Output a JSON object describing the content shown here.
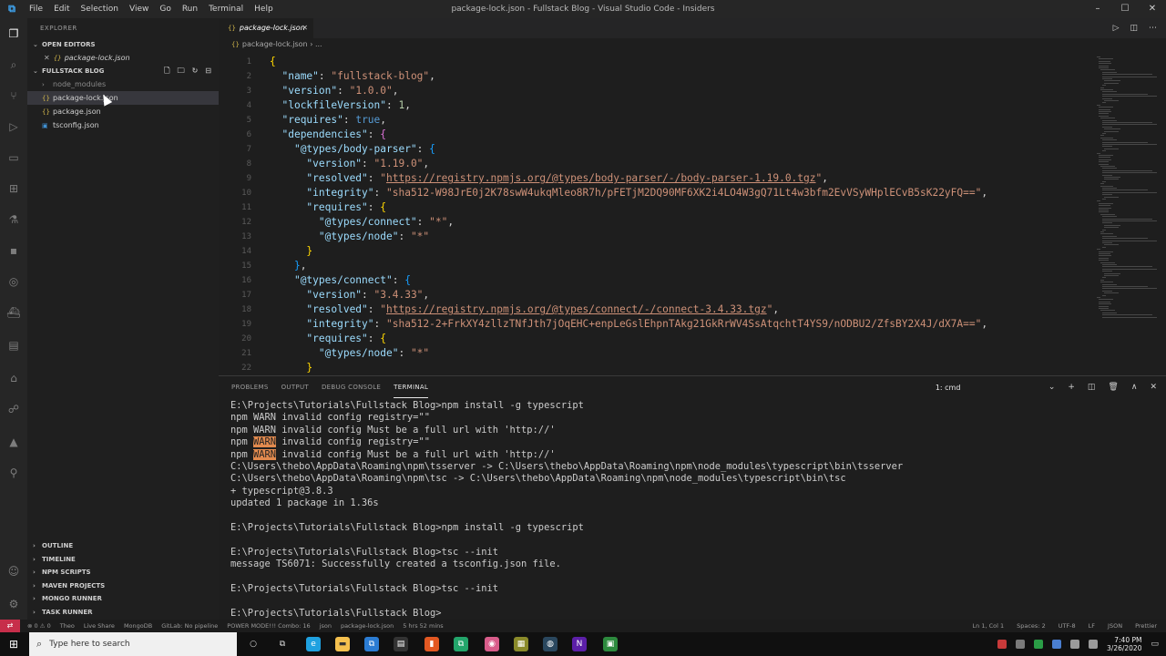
{
  "window": {
    "logo": "⧉",
    "title": "package-lock.json - Fullstack Blog - Visual Studio Code - Insiders",
    "menu": [
      "File",
      "Edit",
      "Selection",
      "View",
      "Go",
      "Run",
      "Terminal",
      "Help"
    ],
    "controls": [
      "–",
      "☐",
      "✕"
    ]
  },
  "activity_bar": {
    "icons": [
      "files-icon",
      "search-icon",
      "source-control-icon",
      "run-debug-icon",
      "remote-explorer-icon",
      "extensions-icon",
      "testing-icon",
      "npm-icon",
      "database-icon",
      "docker-icon",
      "terminal-icon",
      "bookmarks-icon",
      "git-graph-icon",
      "alert-icon",
      "accounts-icon",
      "settings-icon"
    ]
  },
  "sidebar": {
    "header": "EXPLORER",
    "open_editors_label": "OPEN EDITORS",
    "open_editor_file": "package-lock.json",
    "open_editor_close": "✕",
    "workspace_label": "FULLSTACK BLOG",
    "files": [
      {
        "name": "node_modules",
        "kind": "folder"
      },
      {
        "name": "package-lock.json",
        "kind": "json"
      },
      {
        "name": "package.json",
        "kind": "json"
      },
      {
        "name": "tsconfig.json",
        "kind": "ts"
      }
    ],
    "bottom_sections": [
      "OUTLINE",
      "TIMELINE",
      "NPM SCRIPTS",
      "MAVEN PROJECTS",
      "MONGO RUNNER",
      "TASK RUNNER"
    ]
  },
  "tabs": {
    "active": "package-lock.json",
    "icon": "{}",
    "close": "✕"
  },
  "breadcrumb": {
    "file": "package-lock.json",
    "sep": "›",
    "more": "..."
  },
  "editor": {
    "line_numbers": [
      "1",
      "2",
      "3",
      "4",
      "5",
      "6",
      "7",
      "8",
      "9",
      "10",
      "11",
      "12",
      "13",
      "14",
      "15",
      "16",
      "17",
      "18",
      "19",
      "20",
      "21",
      "22"
    ],
    "lines": [
      {
        "indent": "",
        "tokens": [
          {
            "t": "{",
            "c": "br1"
          }
        ]
      },
      {
        "indent": "  ",
        "tokens": [
          {
            "t": "\"name\"",
            "c": "k"
          },
          {
            "t": ": ",
            "c": ""
          },
          {
            "t": "\"fullstack-blog\"",
            "c": "s"
          },
          {
            "t": ",",
            "c": ""
          }
        ]
      },
      {
        "indent": "  ",
        "tokens": [
          {
            "t": "\"version\"",
            "c": "k"
          },
          {
            "t": ": ",
            "c": ""
          },
          {
            "t": "\"1.0.0\"",
            "c": "s"
          },
          {
            "t": ",",
            "c": ""
          }
        ]
      },
      {
        "indent": "  ",
        "tokens": [
          {
            "t": "\"lockfileVersion\"",
            "c": "k"
          },
          {
            "t": ": ",
            "c": ""
          },
          {
            "t": "1",
            "c": "n"
          },
          {
            "t": ",",
            "c": ""
          }
        ]
      },
      {
        "indent": "  ",
        "tokens": [
          {
            "t": "\"requires\"",
            "c": "k"
          },
          {
            "t": ": ",
            "c": ""
          },
          {
            "t": "true",
            "c": "kw"
          },
          {
            "t": ",",
            "c": ""
          }
        ]
      },
      {
        "indent": "  ",
        "tokens": [
          {
            "t": "\"dependencies\"",
            "c": "k"
          },
          {
            "t": ": ",
            "c": ""
          },
          {
            "t": "{",
            "c": "br2"
          }
        ]
      },
      {
        "indent": "    ",
        "tokens": [
          {
            "t": "\"@types/body-parser\"",
            "c": "k"
          },
          {
            "t": ": ",
            "c": ""
          },
          {
            "t": "{",
            "c": "br3"
          }
        ]
      },
      {
        "indent": "      ",
        "tokens": [
          {
            "t": "\"version\"",
            "c": "k"
          },
          {
            "t": ": ",
            "c": ""
          },
          {
            "t": "\"1.19.0\"",
            "c": "s"
          },
          {
            "t": ",",
            "c": ""
          }
        ]
      },
      {
        "indent": "      ",
        "tokens": [
          {
            "t": "\"resolved\"",
            "c": "k"
          },
          {
            "t": ": ",
            "c": ""
          },
          {
            "t": "\"",
            "c": "s"
          },
          {
            "t": "https://registry.npmjs.org/@types/body-parser/-/body-parser-1.19.0.tgz",
            "c": "u"
          },
          {
            "t": "\"",
            "c": "s"
          },
          {
            "t": ",",
            "c": ""
          }
        ]
      },
      {
        "indent": "      ",
        "tokens": [
          {
            "t": "\"integrity\"",
            "c": "k"
          },
          {
            "t": ": ",
            "c": ""
          },
          {
            "t": "\"sha512-W98JrE0j2K78swW4ukqMleo8R7h/pFETjM2DQ90MF6XK2i4LO4W3gQ71Lt4w3bfm2EvVSyWHplECvB5sK22yFQ==\"",
            "c": "s"
          },
          {
            "t": ",",
            "c": ""
          }
        ]
      },
      {
        "indent": "      ",
        "tokens": [
          {
            "t": "\"requires\"",
            "c": "k"
          },
          {
            "t": ": ",
            "c": ""
          },
          {
            "t": "{",
            "c": "br1"
          }
        ]
      },
      {
        "indent": "        ",
        "tokens": [
          {
            "t": "\"@types/connect\"",
            "c": "k"
          },
          {
            "t": ": ",
            "c": ""
          },
          {
            "t": "\"*\"",
            "c": "s"
          },
          {
            "t": ",",
            "c": ""
          }
        ]
      },
      {
        "indent": "        ",
        "tokens": [
          {
            "t": "\"@types/node\"",
            "c": "k"
          },
          {
            "t": ": ",
            "c": ""
          },
          {
            "t": "\"*\"",
            "c": "s"
          }
        ]
      },
      {
        "indent": "      ",
        "tokens": [
          {
            "t": "}",
            "c": "br1"
          }
        ]
      },
      {
        "indent": "    ",
        "tokens": [
          {
            "t": "}",
            "c": "br3"
          },
          {
            "t": ",",
            "c": ""
          }
        ]
      },
      {
        "indent": "    ",
        "tokens": [
          {
            "t": "\"@types/connect\"",
            "c": "k"
          },
          {
            "t": ": ",
            "c": ""
          },
          {
            "t": "{",
            "c": "br3"
          }
        ]
      },
      {
        "indent": "      ",
        "tokens": [
          {
            "t": "\"version\"",
            "c": "k"
          },
          {
            "t": ": ",
            "c": ""
          },
          {
            "t": "\"3.4.33\"",
            "c": "s"
          },
          {
            "t": ",",
            "c": ""
          }
        ]
      },
      {
        "indent": "      ",
        "tokens": [
          {
            "t": "\"resolved\"",
            "c": "k"
          },
          {
            "t": ": ",
            "c": ""
          },
          {
            "t": "\"",
            "c": "s"
          },
          {
            "t": "https://registry.npmjs.org/@types/connect/-/connect-3.4.33.tgz",
            "c": "u"
          },
          {
            "t": "\"",
            "c": "s"
          },
          {
            "t": ",",
            "c": ""
          }
        ]
      },
      {
        "indent": "      ",
        "tokens": [
          {
            "t": "\"integrity\"",
            "c": "k"
          },
          {
            "t": ": ",
            "c": ""
          },
          {
            "t": "\"sha512-2+FrkXY4zllzTNfJth7jOqEHC+enpLeGslEhpnTAkg21GkRrWV4SsAtqchtT4YS9/nODBU2/ZfsBY2X4J/dX7A==\"",
            "c": "s"
          },
          {
            "t": ",",
            "c": ""
          }
        ]
      },
      {
        "indent": "      ",
        "tokens": [
          {
            "t": "\"requires\"",
            "c": "k"
          },
          {
            "t": ": ",
            "c": ""
          },
          {
            "t": "{",
            "c": "br1"
          }
        ]
      },
      {
        "indent": "        ",
        "tokens": [
          {
            "t": "\"@types/node\"",
            "c": "k"
          },
          {
            "t": ": ",
            "c": ""
          },
          {
            "t": "\"*\"",
            "c": "s"
          }
        ]
      },
      {
        "indent": "      ",
        "tokens": [
          {
            "t": "}",
            "c": "br1"
          }
        ]
      }
    ]
  },
  "panel": {
    "tabs": [
      "PROBLEMS",
      "OUTPUT",
      "DEBUG CONSOLE",
      "TERMINAL"
    ],
    "active_tab": "TERMINAL",
    "terminal_select": "1: cmd",
    "actions": [
      "+",
      "◫",
      "🗑",
      "∧",
      "✕"
    ],
    "terminal_lines": [
      "E:\\Projects\\Tutorials\\Fullstack Blog>npm install -g typescript",
      "npm WARN invalid config registry=\"\"",
      "npm WARN invalid config Must be a full url with 'http://'",
      "npm WARN invalid config registry=\"\"",
      "npm WARN invalid config Must be a full url with 'http://'",
      "C:\\Users\\thebo\\AppData\\Roaming\\npm\\tsserver -> C:\\Users\\thebo\\AppData\\Roaming\\npm\\node_modules\\typescript\\bin\\tsserver",
      "C:\\Users\\thebo\\AppData\\Roaming\\npm\\tsc -> C:\\Users\\thebo\\AppData\\Roaming\\npm\\node_modules\\typescript\\bin\\tsc",
      "+ typescript@3.8.3",
      "updated 1 package in 1.36s",
      "",
      "E:\\Projects\\Tutorials\\Fullstack Blog>npm install -g typescript",
      "",
      "E:\\Projects\\Tutorials\\Fullstack Blog>tsc --init",
      "message TS6071: Successfully created a tsconfig.json file.",
      "",
      "E:\\Projects\\Tutorials\\Fullstack Blog>tsc --init",
      "",
      "E:\\Projects\\Tutorials\\Fullstack Blog>"
    ],
    "highlight_warn_lines": [
      3,
      4
    ]
  },
  "statusbar": {
    "left": [
      "⊗ 0 ⚠ 0",
      "Theo",
      "Live Share",
      "MongoDB",
      "GitLab: No pipeline",
      "POWER MODE!!! Combo: 16",
      "json",
      "package-lock.json",
      "5 hrs 52 mins"
    ],
    "right": [
      "Ln 1, Col 1",
      "Spaces: 2",
      "UTF-8",
      "LF",
      "JSON",
      "Prettier"
    ]
  },
  "taskbar": {
    "search_placeholder": "Type here to search",
    "clock_time": "7:40 PM",
    "clock_date": "3/26/2020"
  },
  "colors": {
    "accent": "#007acc",
    "remote_indicator": "#c72e4a",
    "warn_highlight": "#e28a4e"
  }
}
